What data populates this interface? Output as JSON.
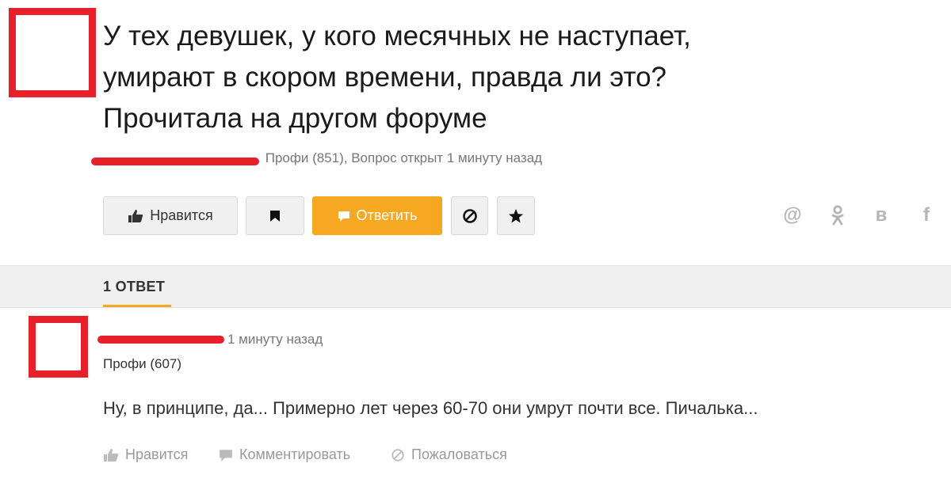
{
  "question": {
    "title_lines": [
      "У тех девушек, у кого месячных не наступает,",
      "умирают в скором времени, правда ли это?",
      "Прочитала на другом форуме"
    ],
    "author_meta": "Профи (851), Вопрос открыт 1 минуту назад"
  },
  "toolbar": {
    "like_label": "Нравится",
    "answer_label": "Ответить"
  },
  "share_icons": [
    "at-icon",
    "odnoklassniki-icon",
    "vk-icon",
    "facebook-icon"
  ],
  "share": {
    "at": "@",
    "vk": "в",
    "fb": "f"
  },
  "answers": {
    "tab_label": "1 ОТВЕТ",
    "items": [
      {
        "time": "1 минуту назад",
        "rank": "Профи (607)",
        "text": "Ну, в принципе, да... Примерно лет через 60-70 они умрут почти все. Пичалька...",
        "actions": {
          "like": "Нравится",
          "comment": "Комментировать",
          "report": "Пожаловаться"
        }
      }
    ]
  },
  "colors": {
    "accent": "#f7a823",
    "redaction": "#e8202a",
    "link": "#3b6bd1"
  }
}
